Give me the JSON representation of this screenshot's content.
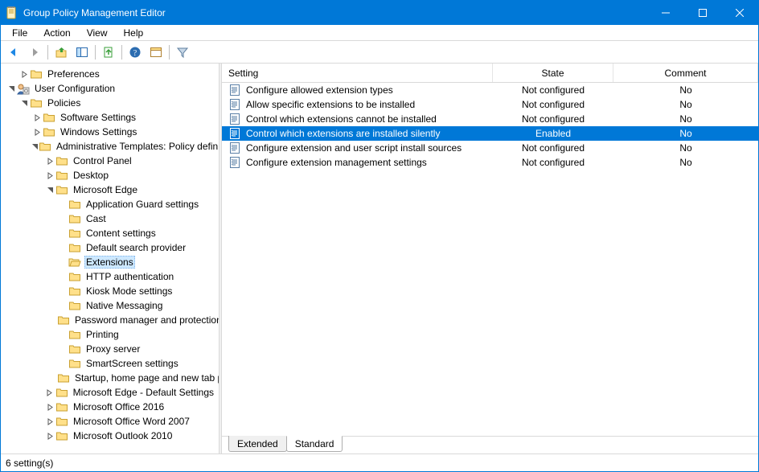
{
  "titlebar": {
    "title": "Group Policy Management Editor"
  },
  "menu": {
    "file": "File",
    "action": "Action",
    "view": "View",
    "help": "Help"
  },
  "columns": {
    "setting": "Setting",
    "state": "State",
    "comment": "Comment"
  },
  "tabs": {
    "extended": "Extended",
    "standard": "Standard"
  },
  "status": "6 setting(s)",
  "tree": [
    {
      "id": "preferences",
      "label": "Preferences",
      "depth": 1,
      "twisty": "closed",
      "icon": "folder"
    },
    {
      "id": "userconfig",
      "label": "User Configuration",
      "depth": 0,
      "twisty": "open",
      "icon": "userconfig"
    },
    {
      "id": "policies",
      "label": "Policies",
      "depth": 1,
      "twisty": "open",
      "icon": "folder"
    },
    {
      "id": "softset",
      "label": "Software Settings",
      "depth": 2,
      "twisty": "closed",
      "icon": "folder"
    },
    {
      "id": "winset",
      "label": "Windows Settings",
      "depth": 2,
      "twisty": "closed",
      "icon": "folder"
    },
    {
      "id": "admtmpl",
      "label": "Administrative Templates: Policy definitions",
      "depth": 2,
      "twisty": "open",
      "icon": "folder"
    },
    {
      "id": "cpanel",
      "label": "Control Panel",
      "depth": 3,
      "twisty": "closed",
      "icon": "folder"
    },
    {
      "id": "desktop",
      "label": "Desktop",
      "depth": 3,
      "twisty": "closed",
      "icon": "folder"
    },
    {
      "id": "msedge",
      "label": "Microsoft Edge",
      "depth": 3,
      "twisty": "open",
      "icon": "folder"
    },
    {
      "id": "appguard",
      "label": "Application Guard settings",
      "depth": 4,
      "twisty": "none",
      "icon": "folder"
    },
    {
      "id": "cast",
      "label": "Cast",
      "depth": 4,
      "twisty": "none",
      "icon": "folder"
    },
    {
      "id": "contentset",
      "label": "Content settings",
      "depth": 4,
      "twisty": "none",
      "icon": "folder"
    },
    {
      "id": "defsearch",
      "label": "Default search provider",
      "depth": 4,
      "twisty": "none",
      "icon": "folder"
    },
    {
      "id": "extensions",
      "label": "Extensions",
      "depth": 4,
      "twisty": "none",
      "icon": "folder-open",
      "selected": true
    },
    {
      "id": "httpauth",
      "label": "HTTP authentication",
      "depth": 4,
      "twisty": "none",
      "icon": "folder"
    },
    {
      "id": "kiosk",
      "label": "Kiosk Mode settings",
      "depth": 4,
      "twisty": "none",
      "icon": "folder"
    },
    {
      "id": "native",
      "label": "Native Messaging",
      "depth": 4,
      "twisty": "none",
      "icon": "folder"
    },
    {
      "id": "pwmgr",
      "label": "Password manager and protection",
      "depth": 4,
      "twisty": "none",
      "icon": "folder"
    },
    {
      "id": "printing",
      "label": "Printing",
      "depth": 4,
      "twisty": "none",
      "icon": "folder"
    },
    {
      "id": "proxy",
      "label": "Proxy server",
      "depth": 4,
      "twisty": "none",
      "icon": "folder"
    },
    {
      "id": "smartscr",
      "label": "SmartScreen settings",
      "depth": 4,
      "twisty": "none",
      "icon": "folder"
    },
    {
      "id": "startup",
      "label": "Startup, home page and new tab page",
      "depth": 4,
      "twisty": "none",
      "icon": "folder"
    },
    {
      "id": "edgedef",
      "label": "Microsoft Edge - Default Settings",
      "depth": 3,
      "twisty": "closed",
      "icon": "folder"
    },
    {
      "id": "off2016",
      "label": "Microsoft Office 2016",
      "depth": 3,
      "twisty": "closed",
      "icon": "folder"
    },
    {
      "id": "word2007",
      "label": "Microsoft Office Word 2007",
      "depth": 3,
      "twisty": "closed",
      "icon": "folder"
    },
    {
      "id": "outlook2010",
      "label": "Microsoft Outlook 2010",
      "depth": 3,
      "twisty": "closed",
      "icon": "folder"
    }
  ],
  "settings": [
    {
      "name": "Configure allowed extension types",
      "state": "Not configured",
      "comment": "No",
      "selected": false
    },
    {
      "name": "Allow specific extensions to be installed",
      "state": "Not configured",
      "comment": "No",
      "selected": false
    },
    {
      "name": "Control which extensions cannot be installed",
      "state": "Not configured",
      "comment": "No",
      "selected": false
    },
    {
      "name": "Control which extensions are installed silently",
      "state": "Enabled",
      "comment": "No",
      "selected": true
    },
    {
      "name": "Configure extension and user script install sources",
      "state": "Not configured",
      "comment": "No",
      "selected": false
    },
    {
      "name": "Configure extension management settings",
      "state": "Not configured",
      "comment": "No",
      "selected": false
    }
  ]
}
